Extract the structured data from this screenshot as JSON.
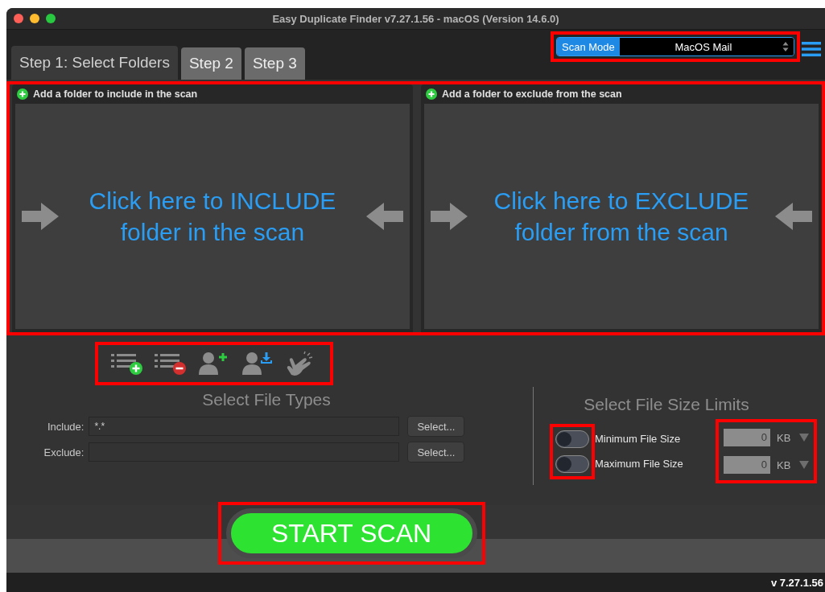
{
  "window": {
    "title": "Easy Duplicate Finder v7.27.1.56 - macOS (Version 14.6.0)"
  },
  "tabs": [
    {
      "label": "Step 1: Select Folders",
      "selected": true
    },
    {
      "label": "Step 2",
      "selected": false
    },
    {
      "label": "Step 3",
      "selected": false
    }
  ],
  "scan_mode": {
    "label": "Scan Mode",
    "value": "MacOS Mail",
    "highlighted": true
  },
  "folder_panels": {
    "highlighted": true,
    "panels": [
      {
        "header": "Add a folder to include in the scan",
        "prompt": "Click here to INCLUDE folder in the scan"
      },
      {
        "header": "Add a folder to exclude from the scan",
        "prompt": "Click here to EXCLUDE folder from the scan"
      }
    ]
  },
  "toolbar": {
    "highlighted": true,
    "buttons": [
      {
        "kind": "list-add"
      },
      {
        "kind": "list-remove"
      },
      {
        "kind": "person-add"
      },
      {
        "kind": "person-download"
      },
      {
        "kind": "hand"
      }
    ]
  },
  "file_types": {
    "title": "Select File Types",
    "rows": [
      {
        "label": "Include:",
        "value": "*.*",
        "button": "Select..."
      },
      {
        "label": "Exclude:",
        "button": "Select..."
      }
    ]
  },
  "size_limits": {
    "title": "Select File Size Limits",
    "toggles_highlighted": true,
    "fields_highlighted": true,
    "rows": [
      {
        "label": "Minimum File Size",
        "on": false,
        "value": "0",
        "unit": "KB"
      },
      {
        "label": "Maximum File Size",
        "on": false,
        "value": "0",
        "unit": "KB"
      }
    ]
  },
  "start_button": {
    "label": "START SCAN",
    "highlighted": true
  },
  "status_bar": {
    "version": "v 7.27.1.56"
  }
}
